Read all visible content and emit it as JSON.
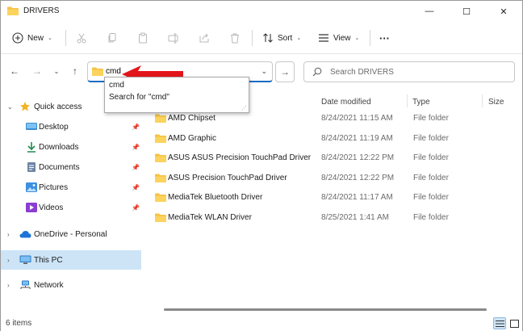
{
  "window": {
    "title": "DRIVERS",
    "controls": {
      "minimize": "—",
      "maximize": "☐",
      "close": "✕"
    }
  },
  "toolbar": {
    "new_label": "New",
    "sort_label": "Sort",
    "view_label": "View",
    "more_label": "···"
  },
  "address": {
    "value": "cmd",
    "search_placeholder": "Search DRIVERS"
  },
  "suggestions": [
    "cmd",
    "Search for \"cmd\""
  ],
  "sidebar": {
    "quick_access": "Quick access",
    "pinned": [
      "Desktop",
      "Downloads",
      "Documents",
      "Pictures",
      "Videos"
    ],
    "onedrive": "OneDrive - Personal",
    "thispc": "This PC",
    "network": "Network"
  },
  "columns": {
    "date": "Date modified",
    "type": "Type",
    "size": "Size"
  },
  "files": [
    {
      "name": "AMD Chipset",
      "date": "8/24/2021 11:15 AM",
      "type": "File folder"
    },
    {
      "name": "AMD Graphic",
      "date": "8/24/2021 11:19 AM",
      "type": "File folder"
    },
    {
      "name": "ASUS ASUS Precision TouchPad Driver",
      "date": "8/24/2021 12:22 PM",
      "type": "File folder"
    },
    {
      "name": "ASUS Precision TouchPad Driver",
      "date": "8/24/2021 12:22 PM",
      "type": "File folder"
    },
    {
      "name": "MediaTek Bluetooth Driver",
      "date": "8/24/2021 11:17 AM",
      "type": "File folder"
    },
    {
      "name": "MediaTek WLAN Driver",
      "date": "8/25/2021 1:41 AM",
      "type": "File folder"
    }
  ],
  "status": {
    "item_count": "6 items"
  },
  "colors": {
    "accent": "#1a6cc4",
    "folder": "#f5c244",
    "selected": "#cde4f7",
    "annotation_arrow": "#e3161b"
  }
}
